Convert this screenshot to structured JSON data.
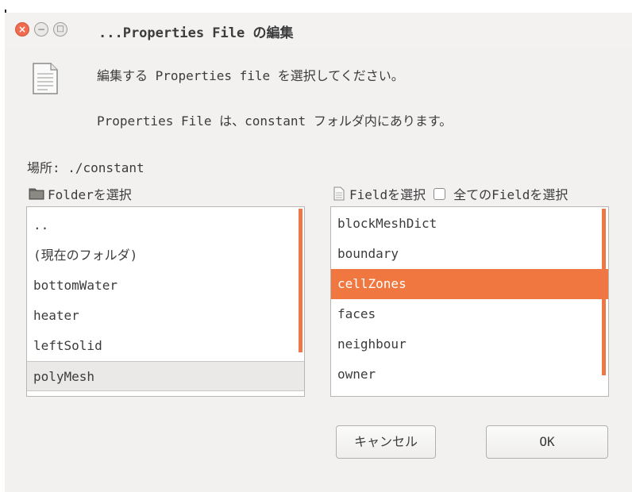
{
  "window": {
    "title": "...Properties File の編集",
    "close_glyph": "×",
    "minimize_glyph": "−",
    "maximize_glyph": "□"
  },
  "message": {
    "line1": "編集する Properties file を選択してください。",
    "line2": "Properties File は、constant フォルダ内にあります。"
  },
  "location": "場所: ./constant",
  "folder_panel": {
    "header": "Folderを選択",
    "items": [
      {
        "label": ".."
      },
      {
        "label": "(現在のフォルダ)"
      },
      {
        "label": "bottomWater"
      },
      {
        "label": "heater"
      },
      {
        "label": "leftSolid"
      },
      {
        "label": "polyMesh"
      }
    ],
    "hovered_index": 5
  },
  "field_panel": {
    "header": "Fieldを選択",
    "select_all_label": "全てのFieldを選択",
    "select_all_checked": false,
    "items": [
      {
        "label": "blockMeshDict"
      },
      {
        "label": "boundary"
      },
      {
        "label": "cellZones"
      },
      {
        "label": "faces"
      },
      {
        "label": "neighbour"
      },
      {
        "label": "owner"
      }
    ],
    "selected_index": 2
  },
  "buttons": {
    "cancel": "キャンセル",
    "ok": "OK"
  },
  "colors": {
    "accent": "#f0773f",
    "window_bg": "#f2f1f0",
    "close_button": "#ef6c4f"
  },
  "icons": {
    "document": "document-icon",
    "folder": "folder-icon",
    "file": "file-icon"
  }
}
